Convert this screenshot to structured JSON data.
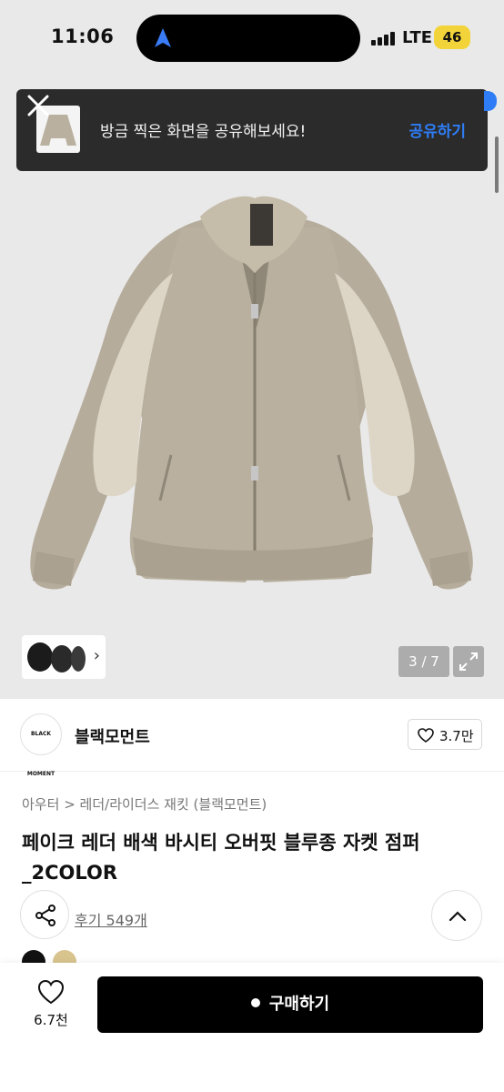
{
  "status_bar": {
    "time": "11:06",
    "network": "LTE",
    "battery": "46"
  },
  "toast": {
    "message": "방금 찍은 화면을 공유해보세요!",
    "action_label": "공유하기"
  },
  "gallery": {
    "counter": "3 / 7",
    "thumbs_arrow": "›"
  },
  "brand": {
    "logo_text": "BLACK MOMENT",
    "name": "블랙모먼트",
    "like_count": "3.7만"
  },
  "product": {
    "breadcrumb": [
      "아우터",
      "레더/라이더스 재킷 (블랙모먼트)"
    ],
    "breadcrumb_separator": ">",
    "title": "페이크 레더 배색 바시티 오버핏 블루종 자켓 점퍼_2COLOR",
    "reviews": "후기 549개",
    "swatches": [
      "#111111",
      "#d9c48e"
    ]
  },
  "bottom_bar": {
    "wish_count": "6.7천",
    "buy_label": "구매하기"
  },
  "colors": {
    "accent": "#2f7df6",
    "jacket": "#b6ad9c",
    "jacket_panel": "#ddd6c8"
  }
}
